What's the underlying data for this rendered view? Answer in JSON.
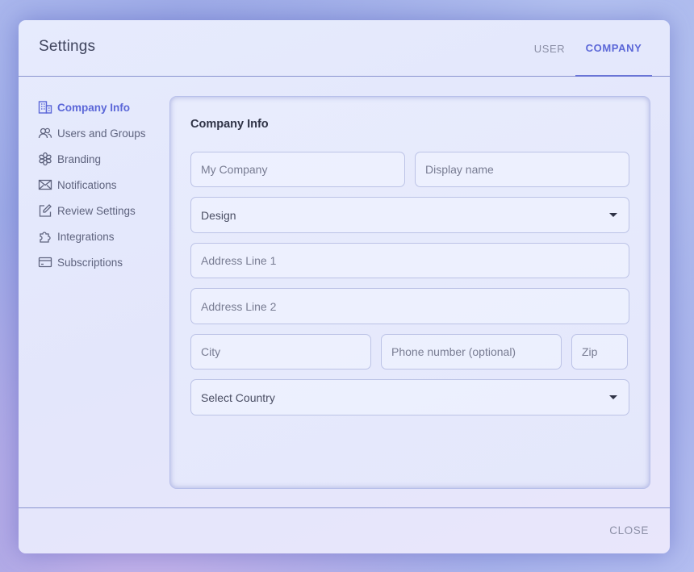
{
  "dialog": {
    "title": "Settings",
    "tabs": [
      {
        "label": "USER",
        "active": false
      },
      {
        "label": "COMPANY",
        "active": true
      }
    ],
    "close_label": "CLOSE"
  },
  "sidebar": {
    "items": [
      {
        "label": "Company Info",
        "icon": "building-icon",
        "active": true
      },
      {
        "label": "Users and Groups",
        "icon": "users-icon",
        "active": false
      },
      {
        "label": "Branding",
        "icon": "flower-icon",
        "active": false
      },
      {
        "label": "Notifications",
        "icon": "envelope-icon",
        "active": false
      },
      {
        "label": "Review Settings",
        "icon": "edit-icon",
        "active": false
      },
      {
        "label": "Integrations",
        "icon": "puzzle-icon",
        "active": false
      },
      {
        "label": "Subscriptions",
        "icon": "credit-card-icon",
        "active": false
      }
    ]
  },
  "form": {
    "title": "Company Info",
    "company_name": {
      "placeholder": "My Company",
      "value": ""
    },
    "display_name": {
      "placeholder": "Display name",
      "value": ""
    },
    "industry": {
      "selected": "Design"
    },
    "address1": {
      "placeholder": "Address Line 1",
      "value": ""
    },
    "address2": {
      "placeholder": "Address Line 2",
      "value": ""
    },
    "city": {
      "placeholder": "City",
      "value": ""
    },
    "phone": {
      "placeholder": "Phone number (optional)",
      "value": ""
    },
    "zip": {
      "placeholder": "Zip",
      "value": ""
    },
    "country": {
      "selected": "Select Country"
    }
  },
  "colors": {
    "accent": "#5b67d8",
    "text": "#40455e",
    "muted": "#8b8fa6",
    "divider": "#8a94cf"
  }
}
